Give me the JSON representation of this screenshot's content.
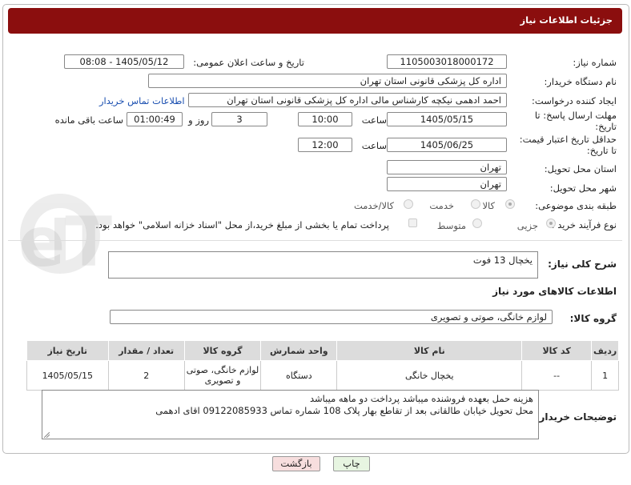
{
  "header": {
    "title": "جزئیات اطلاعات نیاز"
  },
  "fields": {
    "need_number_label": "شماره نیاز:",
    "need_number": "1105003018000172",
    "announce_label": "تاریخ و ساعت اعلان عمومی:",
    "announce_value": "1405/05/12 - 08:08",
    "buyer_org_label": "نام دستگاه خریدار:",
    "buyer_org": "اداره کل پزشکی قانونی استان تهران",
    "creator_label": "ایجاد کننده درخواست:",
    "creator": "احمد ادهمی نیکچه کارشناس مالی اداره کل پزشکی قانونی استان تهران",
    "contact_link": "اطلاعات تماس خریدار",
    "reply_deadline_label": "مهلت ارسال پاسخ: تا تاریخ:",
    "reply_date": "1405/05/15",
    "time_label": "ساعت",
    "reply_time": "10:00",
    "days": "3",
    "days_label": "روز و",
    "remaining": "01:00:49",
    "remaining_label": "ساعت باقی مانده",
    "price_deadline_label": "حداقل تاریخ اعتبار قیمت: تا تاریخ:",
    "price_date": "1405/06/25",
    "price_time": "12:00",
    "province_label": "استان محل تحویل:",
    "province": "تهران",
    "city_label": "شهر محل تحویل:",
    "city": "تهران",
    "category_label": "طبقه بندی موضوعی:",
    "category_options": [
      "کالا",
      "خدمت",
      "کالا/خدمت"
    ],
    "process_label": "نوع فرآیند خرید :",
    "process_options": [
      "جزیی",
      "متوسط"
    ],
    "payment_note": "پرداخت تمام یا بخشی از مبلغ خرید،از محل \"اسناد خزانه اسلامی\" خواهد بود."
  },
  "description": {
    "label": "شرح کلی نیاز:",
    "value": "یخچال 13 فوت"
  },
  "goods_section": {
    "title": "اطلاعات کالاهای مورد نیاز",
    "group_label": "گروه کالا:",
    "group_value": "لوازم خانگی، صوتی و تصویری"
  },
  "table": {
    "headers": [
      "ردیف",
      "کد کالا",
      "نام کالا",
      "واحد شمارش",
      "گروه کالا",
      "تعداد / مقدار",
      "تاریخ نیاز"
    ],
    "rows": [
      {
        "row": "1",
        "code": "--",
        "name": "یخچال خانگی",
        "unit": "دستگاه",
        "group": "لوازم خانگی، صوتی و تصویری",
        "qty": "2",
        "date": "1405/05/15"
      }
    ]
  },
  "buyer_notes": {
    "label": "توضیحات خریدار:",
    "line1": "هزینه حمل بعهده فروشنده میباشد پرداخت دو ماهه میباشد",
    "line2": "محل تحویل خیابان طالقانی بعد از تقاطع بهار پلاک 108 شماره تماس 09122085933 اقای ادهمی"
  },
  "watermark": "AriaTender.neT",
  "buttons": {
    "print": "چاپ",
    "back": "بازگشت"
  },
  "colors": {
    "header": "#8b0e0e",
    "print_button": "#e7f5e1",
    "back_button": "#f7dede",
    "link": "#1a4fb0"
  }
}
